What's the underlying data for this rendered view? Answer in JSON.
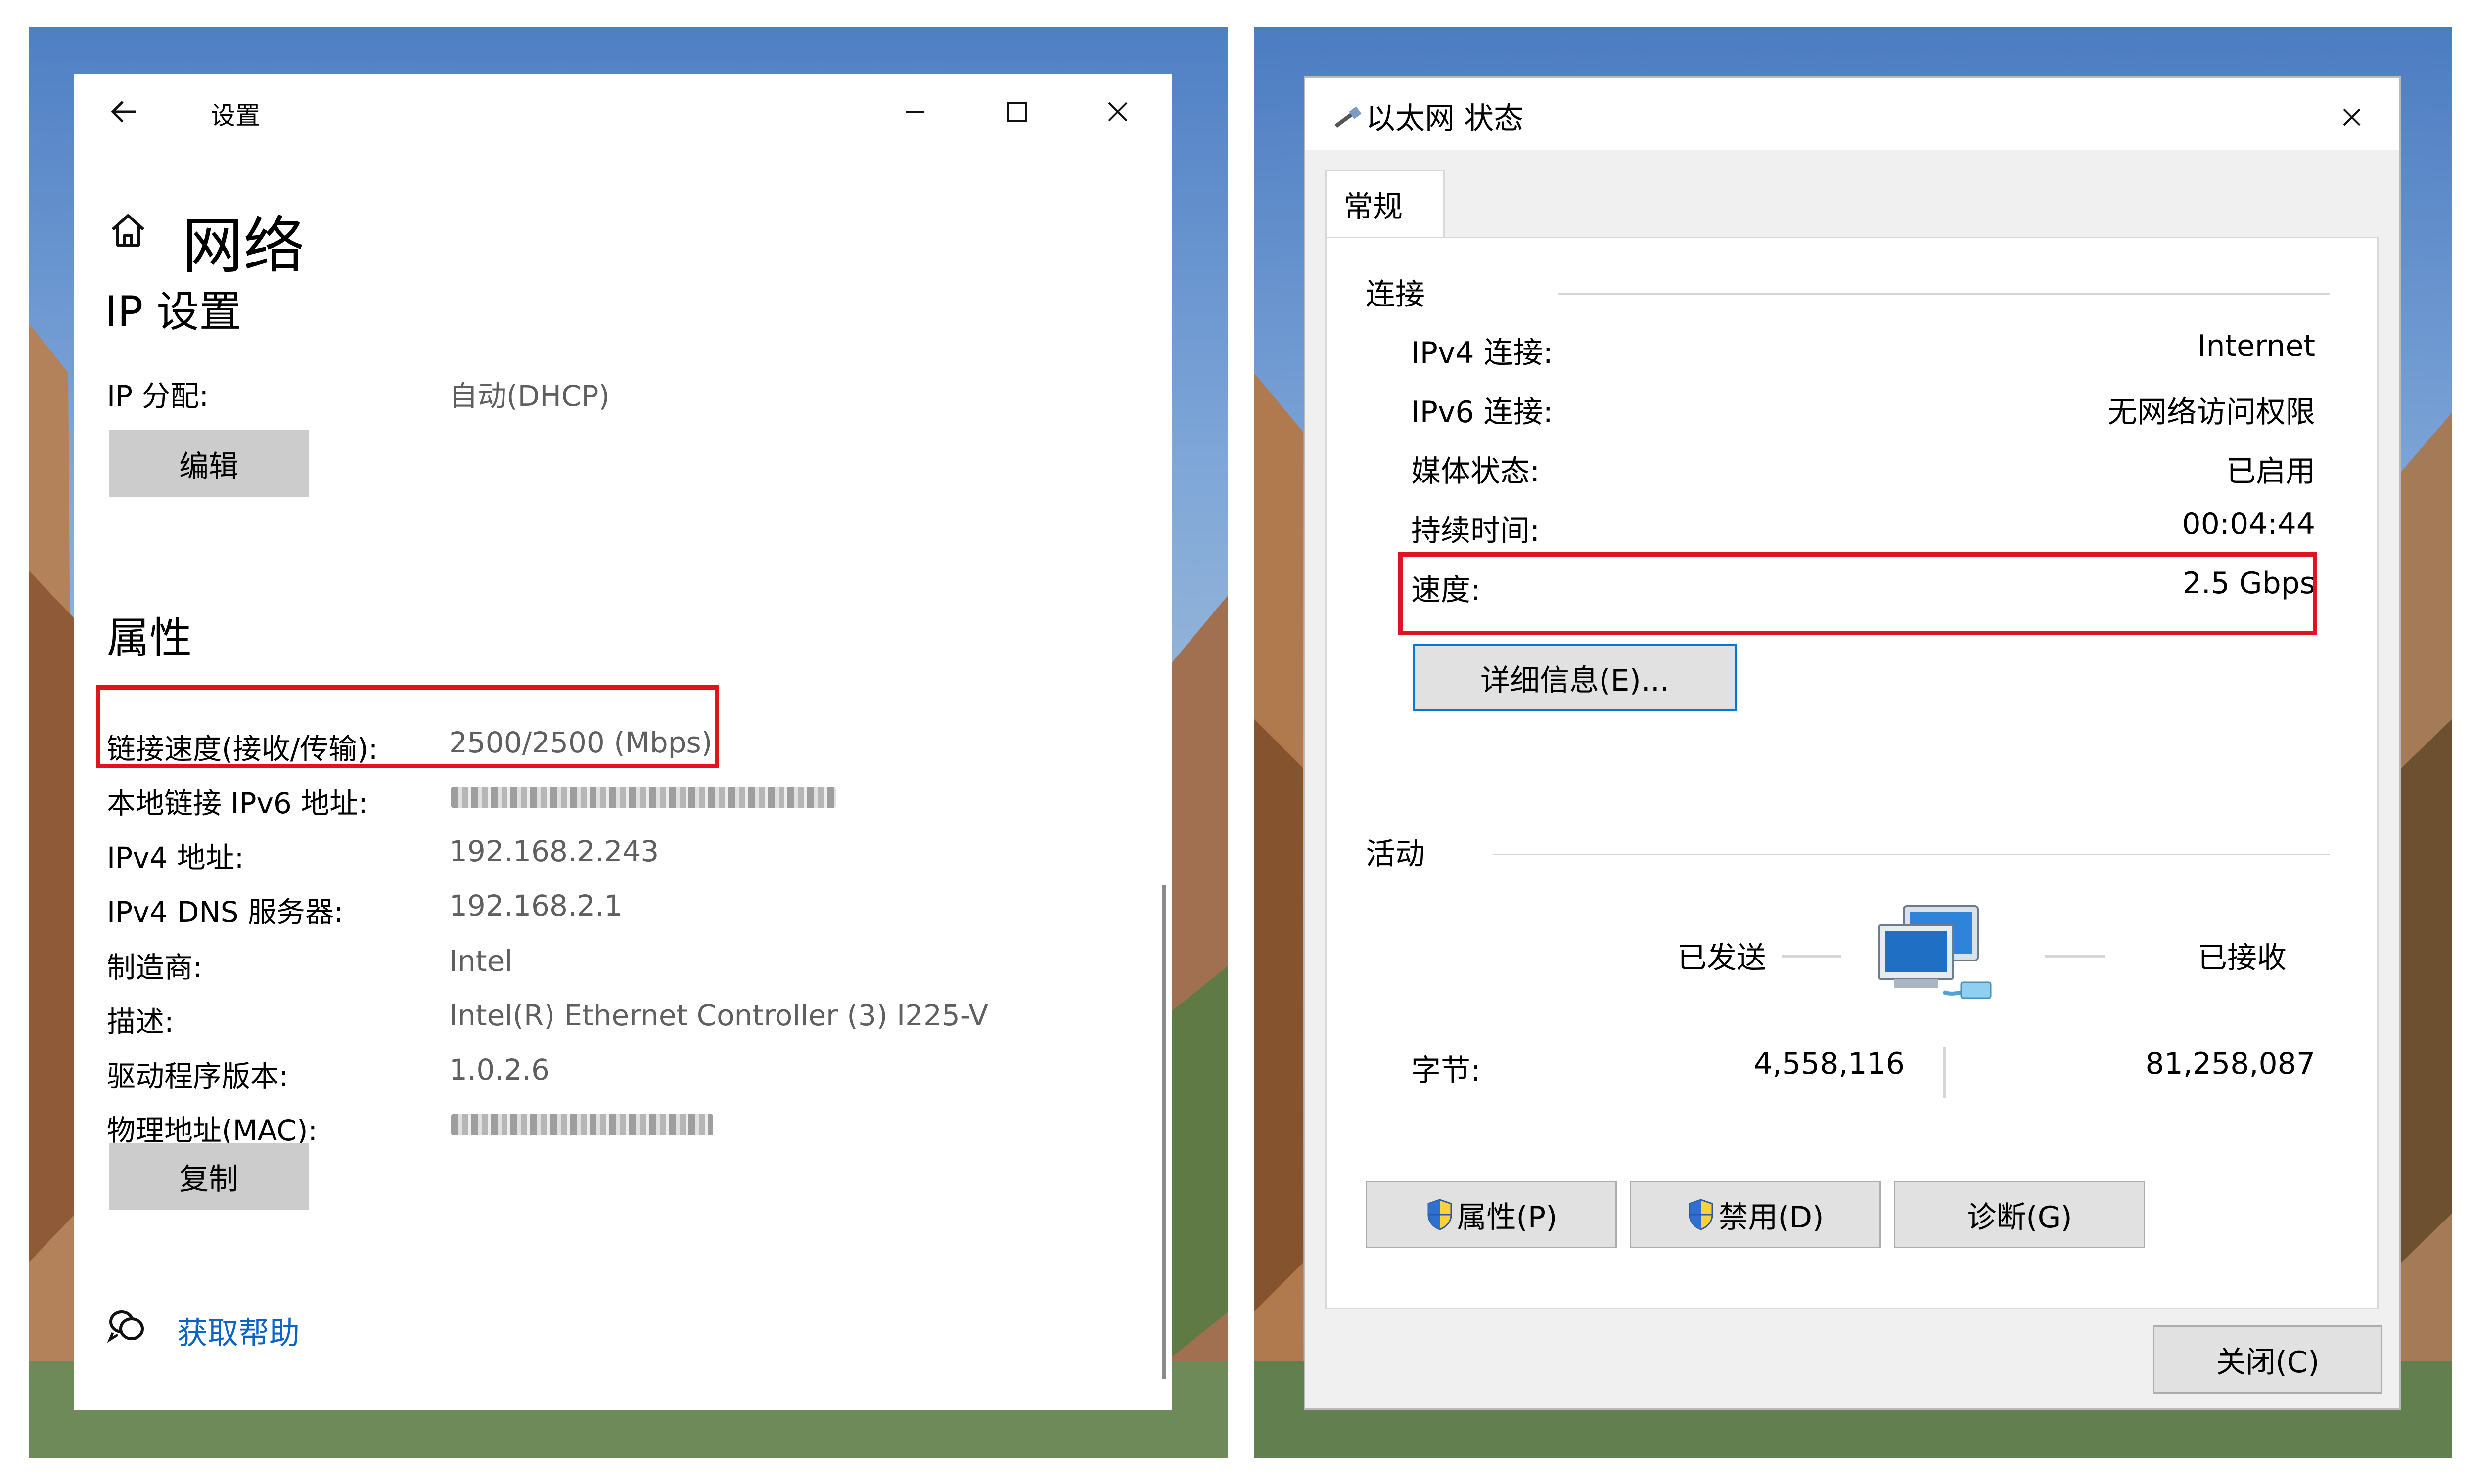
{
  "settings": {
    "title": "设置",
    "home_heading": "网络",
    "section_title": "IP 设置",
    "ip_assignment_label": "IP 分配:",
    "ip_assignment_value": "自动(DHCP)",
    "edit_button": "编辑",
    "properties_heading": "属性",
    "properties": [
      {
        "label": "链接速度(接收/传输):",
        "value": "2500/2500 (Mbps)"
      },
      {
        "label": "本地链接 IPv6 地址:",
        "value": ""
      },
      {
        "label": "IPv4 地址:",
        "value": "192.168.2.243"
      },
      {
        "label": "IPv4 DNS 服务器:",
        "value": "192.168.2.1"
      },
      {
        "label": "制造商:",
        "value": "Intel"
      },
      {
        "label": "描述:",
        "value": "Intel(R) Ethernet Controller (3) I225-V"
      },
      {
        "label": "驱动程序版本:",
        "value": "1.0.2.6"
      },
      {
        "label": "物理地址(MAC):",
        "value": ""
      }
    ],
    "copy_button": "复制",
    "help_link": "获取帮助"
  },
  "ethernet": {
    "title": "以太网 状态",
    "tab": "常规",
    "connection_group": "连接",
    "rows": [
      {
        "label": "IPv4 连接:",
        "value": "Internet"
      },
      {
        "label": "IPv6 连接:",
        "value": "无网络访问权限"
      },
      {
        "label": "媒体状态:",
        "value": "已启用"
      },
      {
        "label": "持续时间:",
        "value": "00:04:44"
      },
      {
        "label": "速度:",
        "value": "2.5 Gbps"
      }
    ],
    "details_button": "详细信息(E)...",
    "activity_group": "活动",
    "sent_label": "已发送",
    "received_label": "已接收",
    "bytes_label": "字节:",
    "bytes_sent": "4,558,116",
    "bytes_received": "81,258,087",
    "properties_button": "属性(P)",
    "disable_button": "禁用(D)",
    "diagnose_button": "诊断(G)",
    "close_button": "关闭(C)"
  },
  "colors": {
    "highlight": "#e0141e",
    "link": "#0a63c9",
    "focus": "#0078d7"
  }
}
